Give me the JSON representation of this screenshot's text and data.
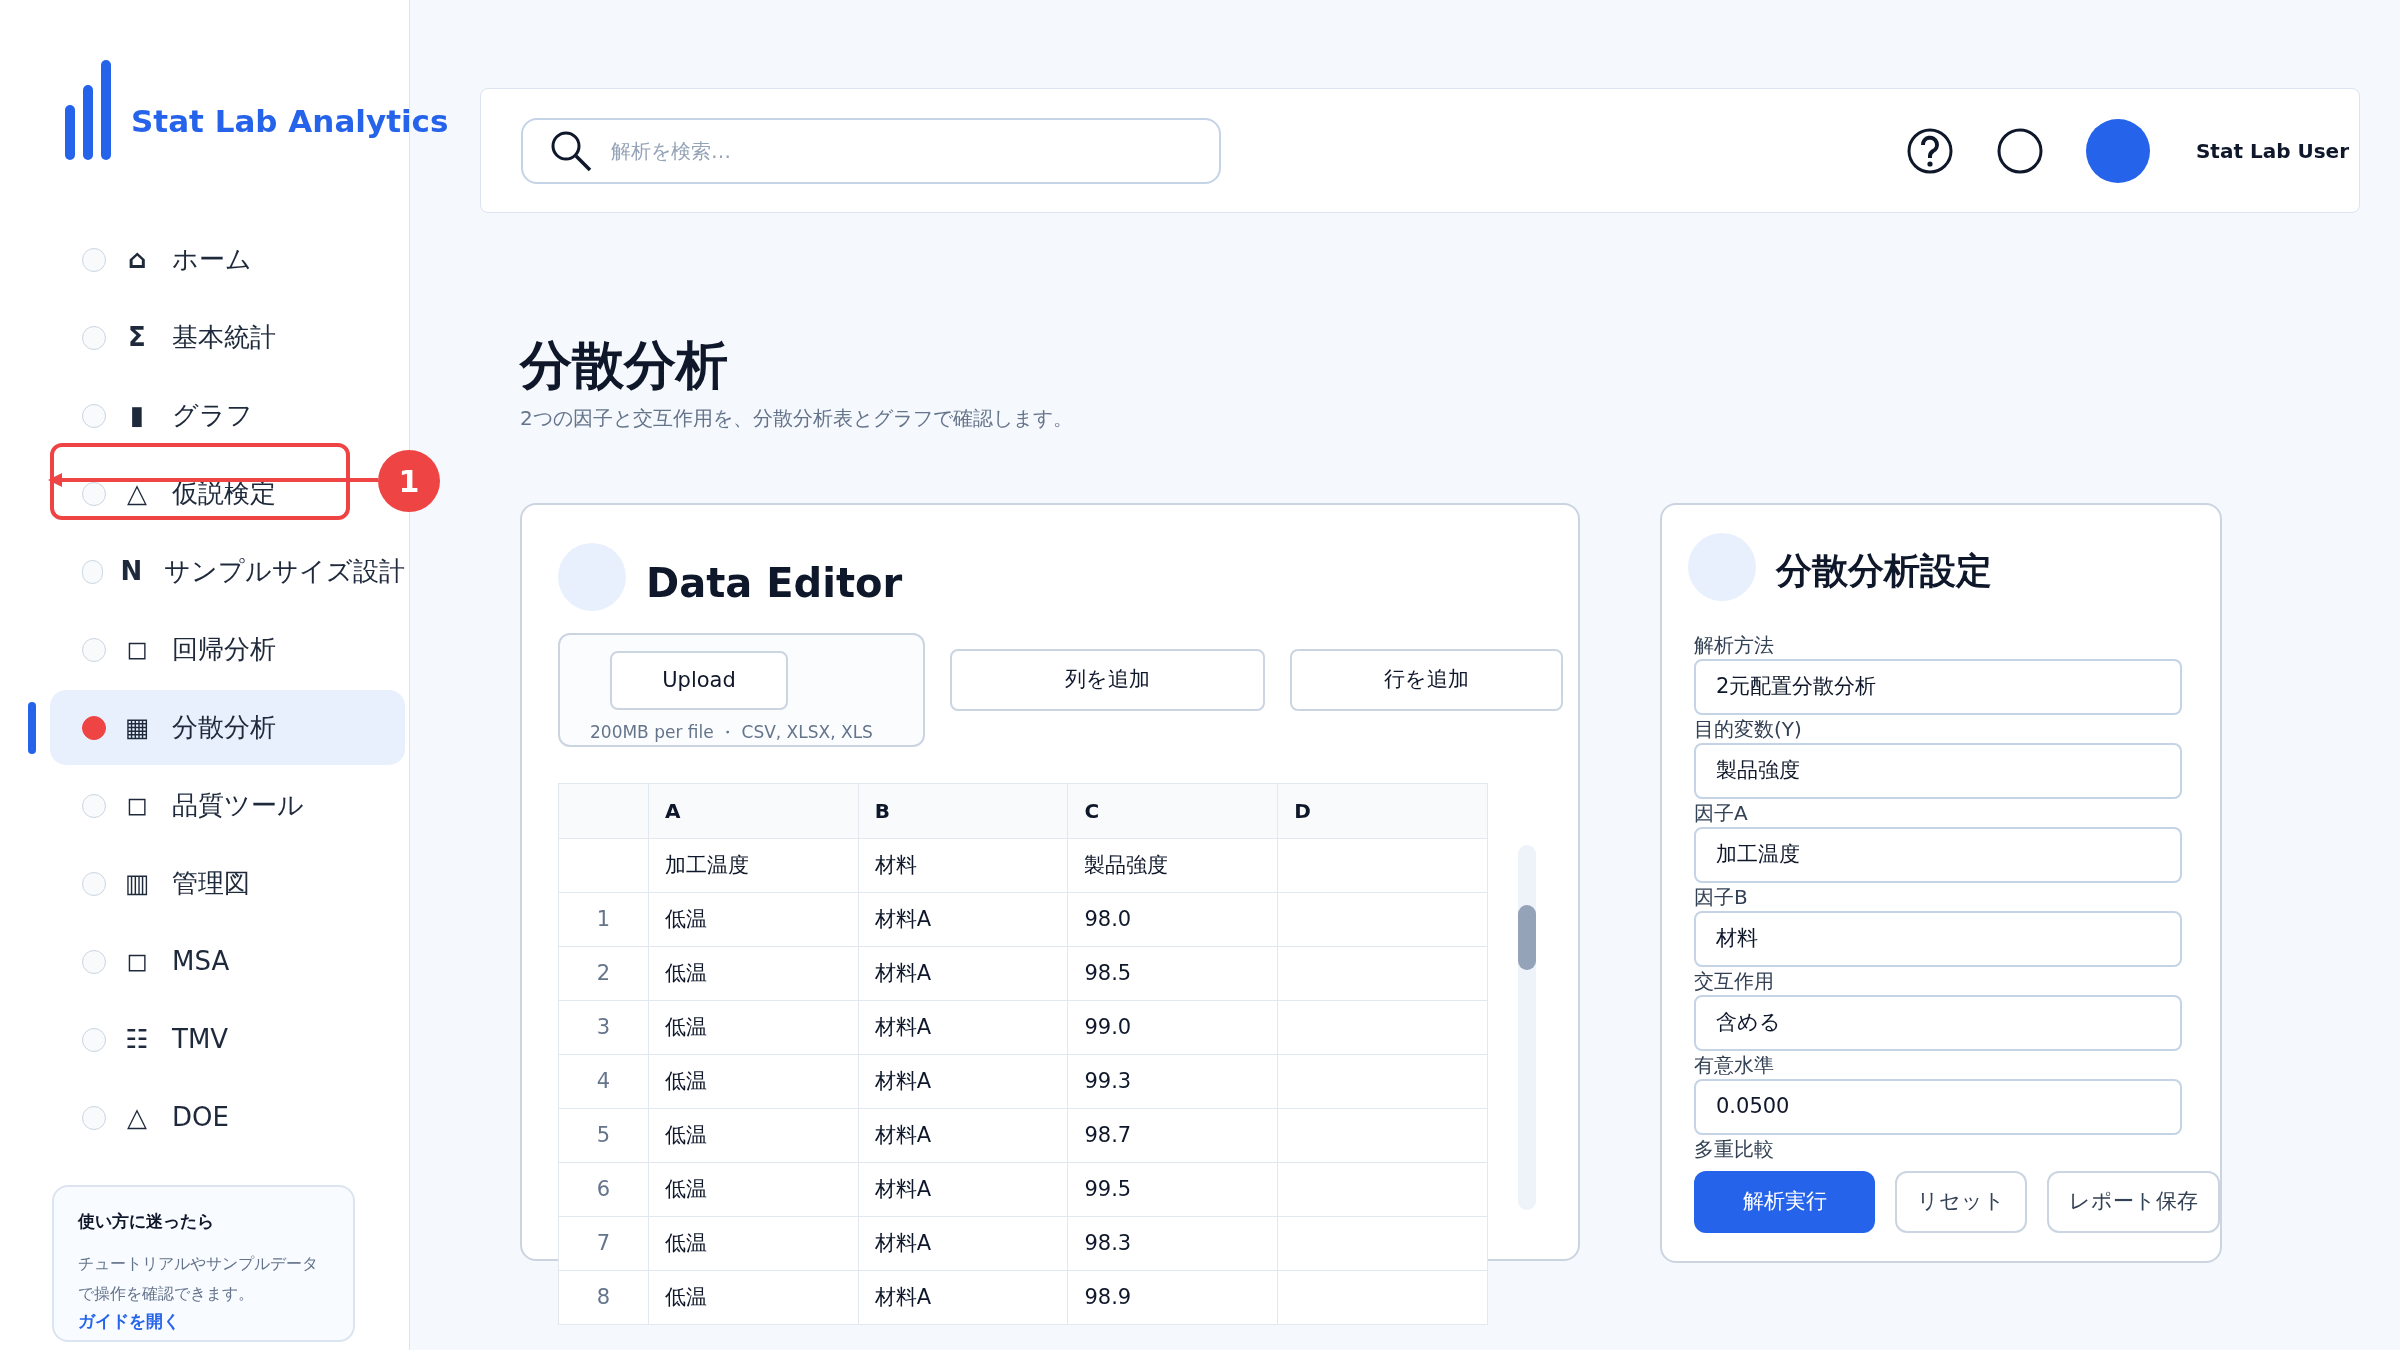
{
  "sidebar": {
    "logo_text": "Stat Lab Analytics",
    "items": [
      {
        "icon": "⌂",
        "label": "ホーム",
        "selected": false
      },
      {
        "icon": "Σ",
        "label": "基本統計",
        "selected": false
      },
      {
        "icon": "▮",
        "label": "グラフ",
        "selected": false
      },
      {
        "icon": "△",
        "label": "仮説検定",
        "selected": false
      },
      {
        "icon": "N",
        "label": "サンプルサイズ設計",
        "selected": false
      },
      {
        "icon": "◻",
        "label": "回帰分析",
        "selected": false
      },
      {
        "icon": "▦",
        "label": "分散分析",
        "selected": true
      },
      {
        "icon": "◻",
        "label": "品質ツール",
        "selected": false
      },
      {
        "icon": "▥",
        "label": "管理図",
        "selected": false
      },
      {
        "icon": "◻",
        "label": "MSA",
        "selected": false
      },
      {
        "icon": "☷",
        "label": "TMV",
        "selected": false
      },
      {
        "icon": "△",
        "label": "DOE",
        "selected": false
      }
    ],
    "help_card": {
      "title": "使い方に迷ったら",
      "body": "チュートリアルやサンプルデータで操作を確認できます。",
      "link": "ガイドを開く"
    }
  },
  "annotation": {
    "badge": "1"
  },
  "header": {
    "search": {
      "placeholder": "解析を検索…"
    },
    "user_name": "Stat Lab User"
  },
  "page": {
    "title": "分散分析",
    "subtitle": "2つの因子と交互作用を、分散分析表とグラフで確認します。"
  },
  "data_editor": {
    "title": "Data Editor",
    "upload": {
      "button": "Upload",
      "caption": "200MB per file ・ CSV, XLSX, XLS"
    },
    "buttons": [
      "列を追加",
      "行を追加"
    ],
    "table": {
      "columns": [
        "A",
        "B",
        "C",
        "D"
      ],
      "rows": [
        {
          "cells": [
            "加工温度",
            "材料",
            "製品強度"
          ]
        },
        {
          "number": "1",
          "cells": [
            "低温",
            "材料A",
            "98.0"
          ]
        },
        {
          "number": "2",
          "cells": [
            "低温",
            "材料A",
            "98.5"
          ]
        },
        {
          "number": "3",
          "cells": [
            "低温",
            "材料A",
            "99.0"
          ]
        },
        {
          "number": "4",
          "cells": [
            "低温",
            "材料A",
            "99.3"
          ]
        },
        {
          "number": "5",
          "cells": [
            "低温",
            "材料A",
            "98.7"
          ]
        },
        {
          "number": "6",
          "cells": [
            "低温",
            "材料A",
            "99.5"
          ]
        },
        {
          "number": "7",
          "cells": [
            "低温",
            "材料A",
            "98.3"
          ]
        },
        {
          "number": "8",
          "cells": [
            "低温",
            "材料A",
            "98.9"
          ]
        }
      ]
    }
  },
  "settings": {
    "title": "分散分析設定",
    "fields": [
      {
        "label": "解析方法",
        "value": "2元配置分散分析"
      },
      {
        "label": "目的変数(Y)",
        "value": "製品強度"
      },
      {
        "label": "因子A",
        "value": "加工温度"
      },
      {
        "label": "因子B",
        "value": "材料"
      },
      {
        "label": "交互作用",
        "value": "含める"
      },
      {
        "label": "有意水準",
        "value": "0.0500"
      }
    ],
    "last_label": "多重比較",
    "buttons": [
      {
        "label": "解析実行",
        "primary": true
      },
      {
        "label": "リセット",
        "primary": false
      },
      {
        "label": "レポート保存",
        "primary": false
      }
    ]
  }
}
